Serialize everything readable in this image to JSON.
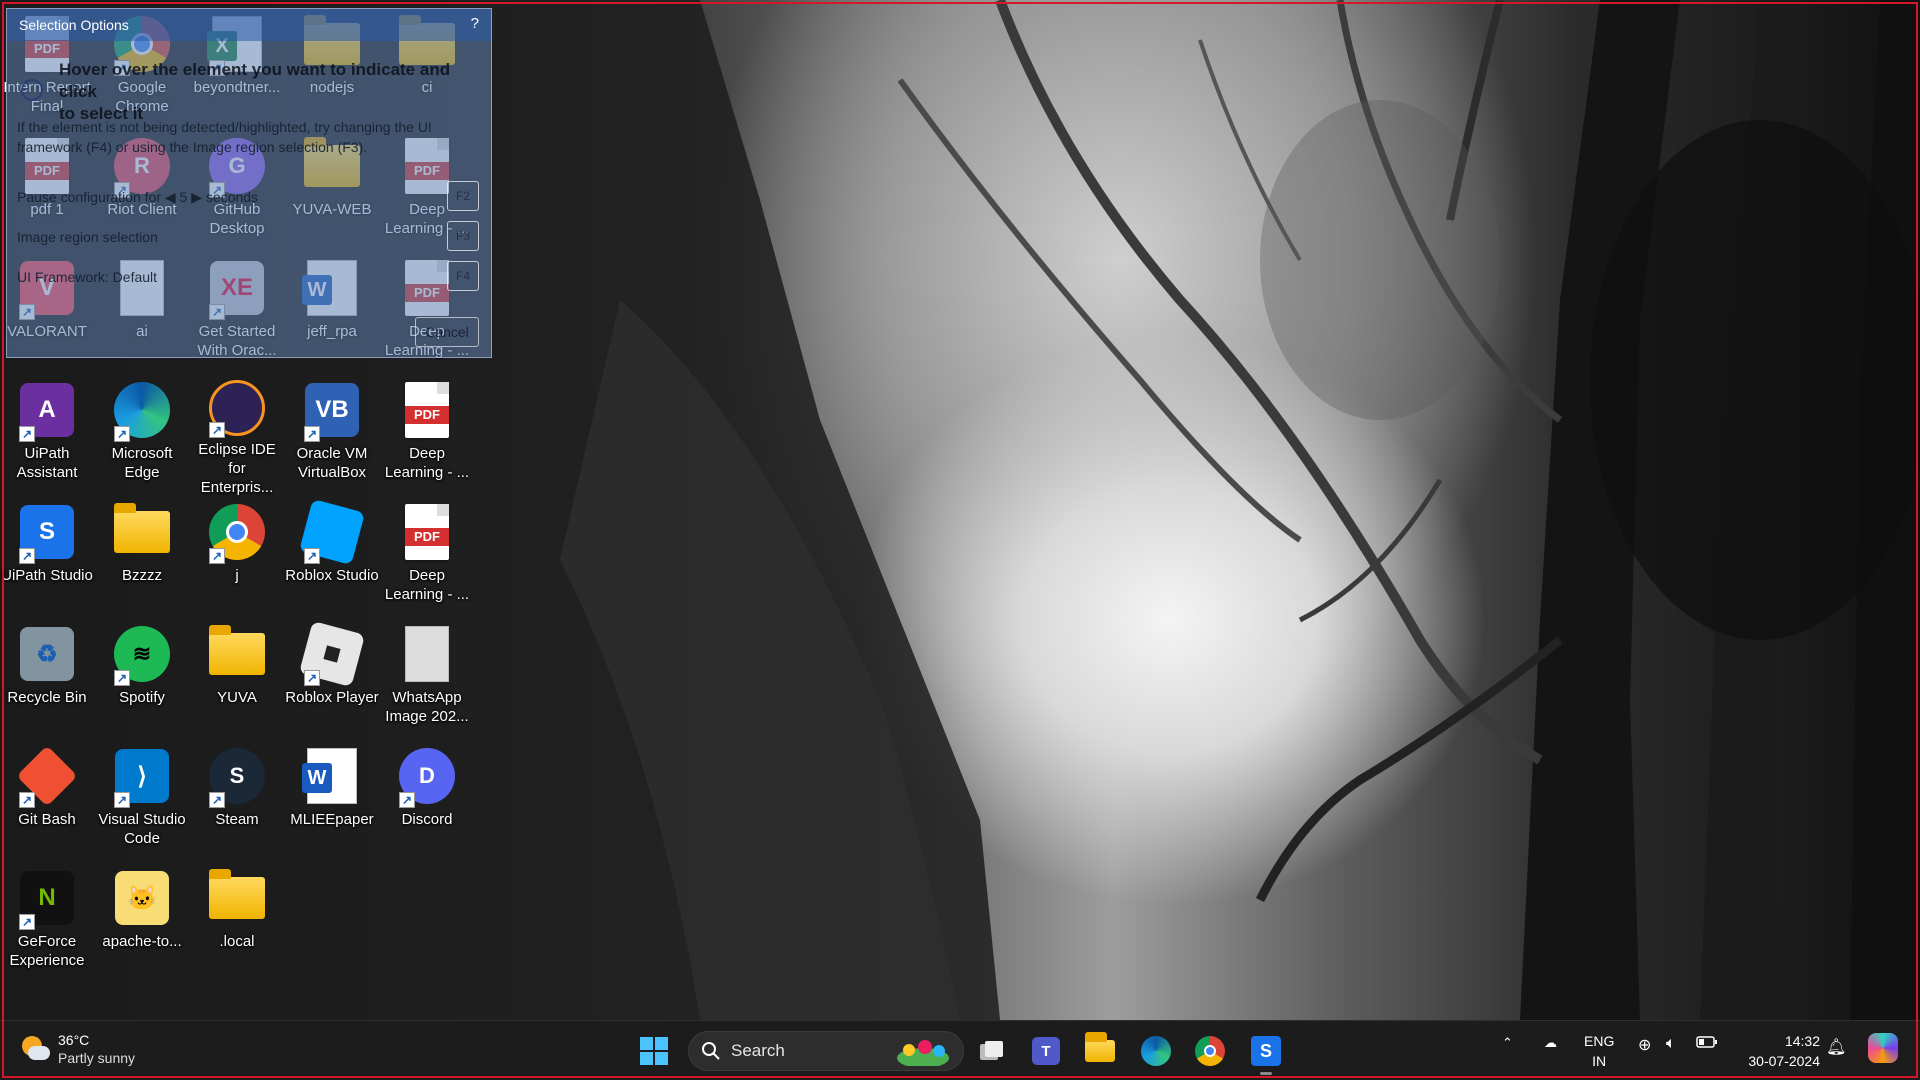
{
  "selection_panel": {
    "title": "Selection Options",
    "help": "?",
    "hover_line1": "Hover over the element you want to indicate and click",
    "hover_line2": "to select it",
    "hint": "If the element is not being detected/highlighted, try changing the UI framework (F4) or using the Image region selection (F3).",
    "pause_label": "Pause configuration for",
    "pause_value": "5",
    "pause_unit": "seconds",
    "image_region": "Image region selection",
    "ui_framework": "UI Framework: Default",
    "keys": [
      "F2",
      "F3",
      "F4"
    ],
    "cancel": "Cancel"
  },
  "desktop_icons": [
    {
      "label": "Intern Report Final",
      "icon": "pdf-icon"
    },
    {
      "label": "Google Chrome",
      "icon": "chrome-icon"
    },
    {
      "label": "beyondtner...",
      "icon": "excel-icon"
    },
    {
      "label": "nodejs",
      "icon": "folder-icon"
    },
    {
      "label": "ci",
      "icon": "folder-icon"
    },
    {
      "label": "pdf 1",
      "icon": "pdf-icon"
    },
    {
      "label": "Riot Client",
      "icon": "riot-icon"
    },
    {
      "label": "GitHub Desktop",
      "icon": "github-icon"
    },
    {
      "label": "YUVA-WEB",
      "icon": "folder-icon"
    },
    {
      "label": "Deep Learning - ...",
      "icon": "pdf-icon"
    },
    {
      "label": "VALORANT",
      "icon": "valorant-icon"
    },
    {
      "label": "ai",
      "icon": "document-icon"
    },
    {
      "label": "Get Started With Orac...",
      "icon": "oracle-icon"
    },
    {
      "label": "jeff_rpa",
      "icon": "word-icon"
    },
    {
      "label": "Deep Learning - ...",
      "icon": "pdf-icon"
    },
    {
      "label": "UiPath Assistant",
      "icon": "uipath-assistant-icon"
    },
    {
      "label": "Microsoft Edge",
      "icon": "edge-icon"
    },
    {
      "label": "Eclipse IDE for Enterpris...",
      "icon": "eclipse-icon"
    },
    {
      "label": "Oracle VM VirtualBox",
      "icon": "virtualbox-icon"
    },
    {
      "label": "Deep Learning - ...",
      "icon": "pdf-icon"
    },
    {
      "label": "UiPath Studio",
      "icon": "uipath-studio-icon"
    },
    {
      "label": "Bzzzz",
      "icon": "folder-icon"
    },
    {
      "label": "j",
      "icon": "chrome-icon"
    },
    {
      "label": "Roblox Studio",
      "icon": "roblox-studio-icon"
    },
    {
      "label": "Deep Learning - ...",
      "icon": "pdf-icon"
    },
    {
      "label": "Recycle Bin",
      "icon": "recycle-bin-icon"
    },
    {
      "label": "Spotify",
      "icon": "spotify-icon"
    },
    {
      "label": "YUVA",
      "icon": "folder-icon"
    },
    {
      "label": "Roblox Player",
      "icon": "roblox-icon"
    },
    {
      "label": "WhatsApp Image 202...",
      "icon": "image-icon"
    },
    {
      "label": "Git Bash",
      "icon": "git-icon"
    },
    {
      "label": "Visual Studio Code",
      "icon": "vscode-icon"
    },
    {
      "label": "Steam",
      "icon": "steam-icon"
    },
    {
      "label": "MLIEEpaper",
      "icon": "word-icon"
    },
    {
      "label": "Discord",
      "icon": "discord-icon"
    },
    {
      "label": "GeForce Experience",
      "icon": "geforce-icon"
    },
    {
      "label": "apache-to...",
      "icon": "tomcat-icon"
    },
    {
      "label": ".local",
      "icon": "folder-icon"
    }
  ],
  "taskbar": {
    "weather_temp": "36°C",
    "weather_cond": "Partly sunny",
    "search_placeholder": "Search",
    "lang_top": "ENG",
    "lang_bottom": "IN",
    "time": "14:32",
    "date": "30-07-2024"
  },
  "colors": {
    "taskbar_bg": "#1c1c1c",
    "accent": "#4cc2ff",
    "frame": "#d4182a"
  }
}
